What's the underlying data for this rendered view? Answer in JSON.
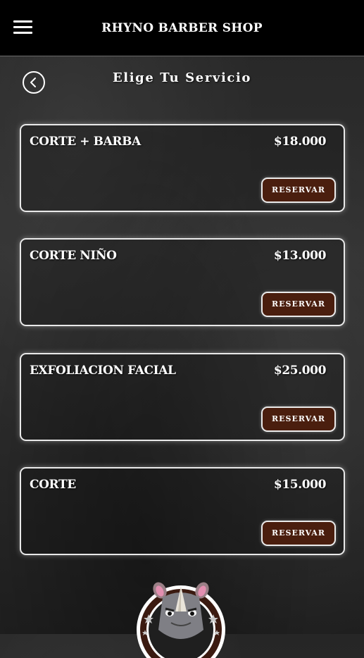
{
  "header": {
    "menu_icon": "hamburger-menu-icon",
    "title": "RHYNO BARBER SHOP"
  },
  "page": {
    "back_icon": "chevron-left-icon",
    "title": "Elige Tu Servicio"
  },
  "services": [
    {
      "name": "CORTE + BARBA",
      "price": "$18.000",
      "button_label": "RESERVAR"
    },
    {
      "name": "CORTE NIÑO",
      "price": "$13.000",
      "button_label": "RESERVAR"
    },
    {
      "name": "EXFOLIACION FACIAL",
      "price": "$25.000",
      "button_label": "RESERVAR"
    },
    {
      "name": "CORTE",
      "price": "$15.000",
      "button_label": "RESERVAR"
    }
  ],
  "logo": {
    "icon": "rhino-logo-icon"
  },
  "colors": {
    "header_bg": "#000000",
    "button_bg": "#4a1e0e",
    "card_border": "#e9e9e9",
    "text": "#ffffff"
  }
}
